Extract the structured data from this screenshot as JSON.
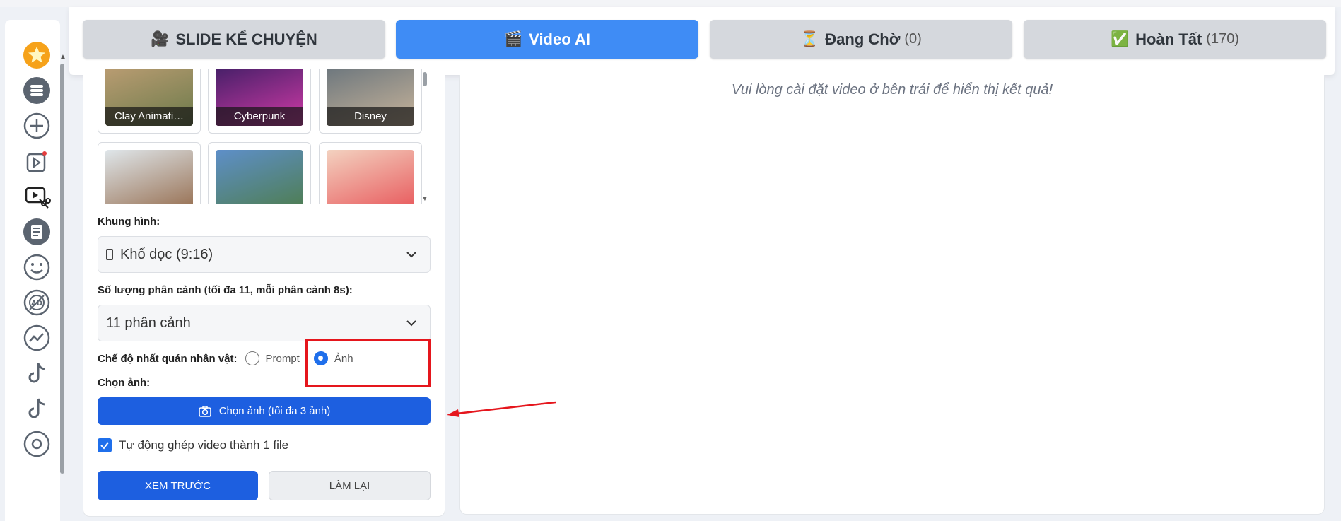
{
  "tabs": [
    {
      "emoji": "🎥",
      "label": "SLIDE KỂ CHUYỆN",
      "count": ""
    },
    {
      "emoji": "🎬",
      "label": "Video AI",
      "count": ""
    },
    {
      "emoji": "⏳",
      "label": "Đang Chờ",
      "count": "(0)"
    },
    {
      "emoji": "✅",
      "label": "Hoàn Tất",
      "count": "(170)"
    }
  ],
  "active_tab": "Video AI",
  "rail_icons": [
    "star-icon",
    "stack-icon",
    "plus-circle-icon",
    "video-sparkle-icon",
    "video-cut-icon",
    "document-icon",
    "smiley-icon",
    "ad-block-icon",
    "trend-icon",
    "tiktok-icon",
    "tiktok-icon",
    "at-icon"
  ],
  "styles": [
    {
      "label": "Clay Animati…",
      "colors": [
        "#c9a37a",
        "#6b7a4a"
      ]
    },
    {
      "label": "Cyberpunk",
      "colors": [
        "#2b1a5c",
        "#d03aa6"
      ]
    },
    {
      "label": "Disney",
      "colors": [
        "#5b6b78",
        "#c8b49a"
      ]
    },
    {
      "label": "",
      "colors": [
        "#dfe6ea",
        "#8a5a36"
      ]
    },
    {
      "label": "",
      "colors": [
        "#5e8fc9",
        "#4b7a3a"
      ]
    },
    {
      "label": "",
      "colors": [
        "#f3d2c0",
        "#e6434a"
      ]
    }
  ],
  "frame": {
    "label": "Khung hình:",
    "value": "Khổ dọc (9:16)"
  },
  "scenes": {
    "label": "Số lượng phân cảnh (tối đa 11, mỗi phân cảnh 8s):",
    "value": "11 phân cảnh"
  },
  "consistency": {
    "label": "Chế độ nhất quán nhân vật:",
    "options": [
      "Prompt",
      "Ảnh"
    ],
    "selected": "Ảnh"
  },
  "choose_image": {
    "label": "Chọn ảnh:",
    "button": "Chọn ảnh (tối đa 3 ảnh)"
  },
  "auto_merge": {
    "label": "Tự động ghép video thành 1 file",
    "checked": true
  },
  "actions": {
    "preview": "XEM TRƯỚC",
    "reset": "LÀM LẠI"
  },
  "result": {
    "message": "Vui lòng cài đặt video ở bên trái để hiển thị kết quả!"
  },
  "colors": {
    "accent": "#3f8cf5",
    "primary_button": "#1d5fe0",
    "annotation": "#e5161d"
  }
}
